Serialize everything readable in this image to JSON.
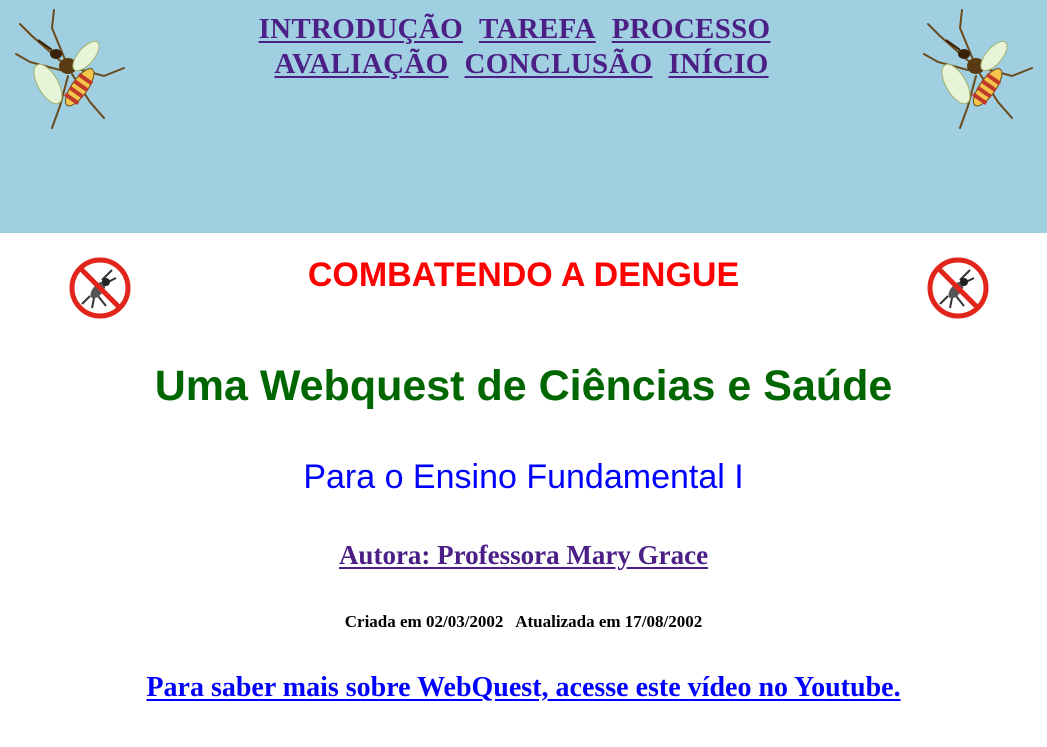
{
  "nav": {
    "row1": [
      "INTRODUÇÃO",
      "TAREFA",
      "PROCESSO"
    ],
    "row2": [
      "AVALIAÇÃO",
      "CONCLUSÃO",
      "INÍCIO"
    ]
  },
  "main": {
    "title": "COMBATENDO A DENGUE",
    "heading": "Uma Webquest de Ciências e Saúde",
    "subheading": "Para o Ensino Fundamental I",
    "author_link": "Autora: Professora Mary Grace",
    "dates": "Criada em 02/03/2002   Atualizada em 17/08/2002",
    "youtube_link": "Para saber mais sobre WebQuest, acesse este vídeo no Youtube."
  },
  "icons": {
    "mosquito": "mosquito-icon",
    "no_mosquito": "no-mosquito-icon"
  },
  "colors": {
    "header_bg": "#9fcfe0",
    "nav_link": "#4b1f86",
    "title_red": "#ff0000",
    "heading_green": "#006600",
    "subheading_blue": "#0000ff",
    "youtube_link": "#0000ff"
  }
}
